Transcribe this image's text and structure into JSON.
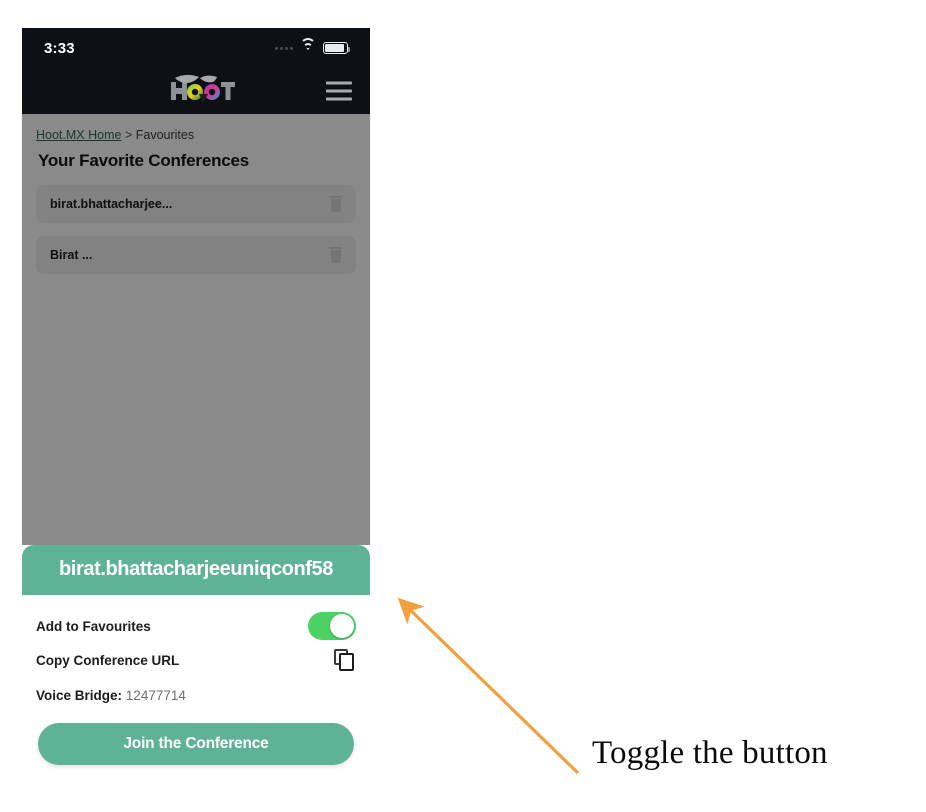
{
  "status_bar": {
    "time": "3:33",
    "signal_icon": "signal-dots-icon",
    "wifi_icon": "wifi-icon",
    "battery_icon": "battery-icon"
  },
  "app_header": {
    "logo_text": "HOOT",
    "logo_icon": "hoot-owl-logo",
    "menu_icon": "hamburger-menu-icon"
  },
  "breadcrumb": {
    "home_label": "Hoot.MX Home",
    "separator": ">",
    "current_label": "Favourites"
  },
  "page": {
    "title": "Your Favorite Conferences",
    "favorites": [
      {
        "name": "birat.bhattacharjee...",
        "delete_icon": "trash-icon"
      },
      {
        "name": "Birat ...",
        "delete_icon": "trash-icon"
      }
    ]
  },
  "sheet": {
    "title": "birat.bhattacharjeeuniqconf58",
    "rows": [
      {
        "label": "Add to Favourites",
        "control": "toggle",
        "state": "on"
      },
      {
        "label": "Copy Conference URL",
        "control": "copy-icon"
      }
    ],
    "voice_bridge_label": "Voice Bridge:",
    "voice_bridge_value": "12477714",
    "join_label": "Join the Conference"
  },
  "annotation": {
    "text": "Toggle the button",
    "arrow_color": "#f0a03c"
  },
  "colors": {
    "brand_green": "#5eb396",
    "toggle_green": "#4cd264",
    "header_dark": "#0d1014",
    "link_green": "#2f6b4f",
    "annotation_orange": "#f0a03c"
  }
}
